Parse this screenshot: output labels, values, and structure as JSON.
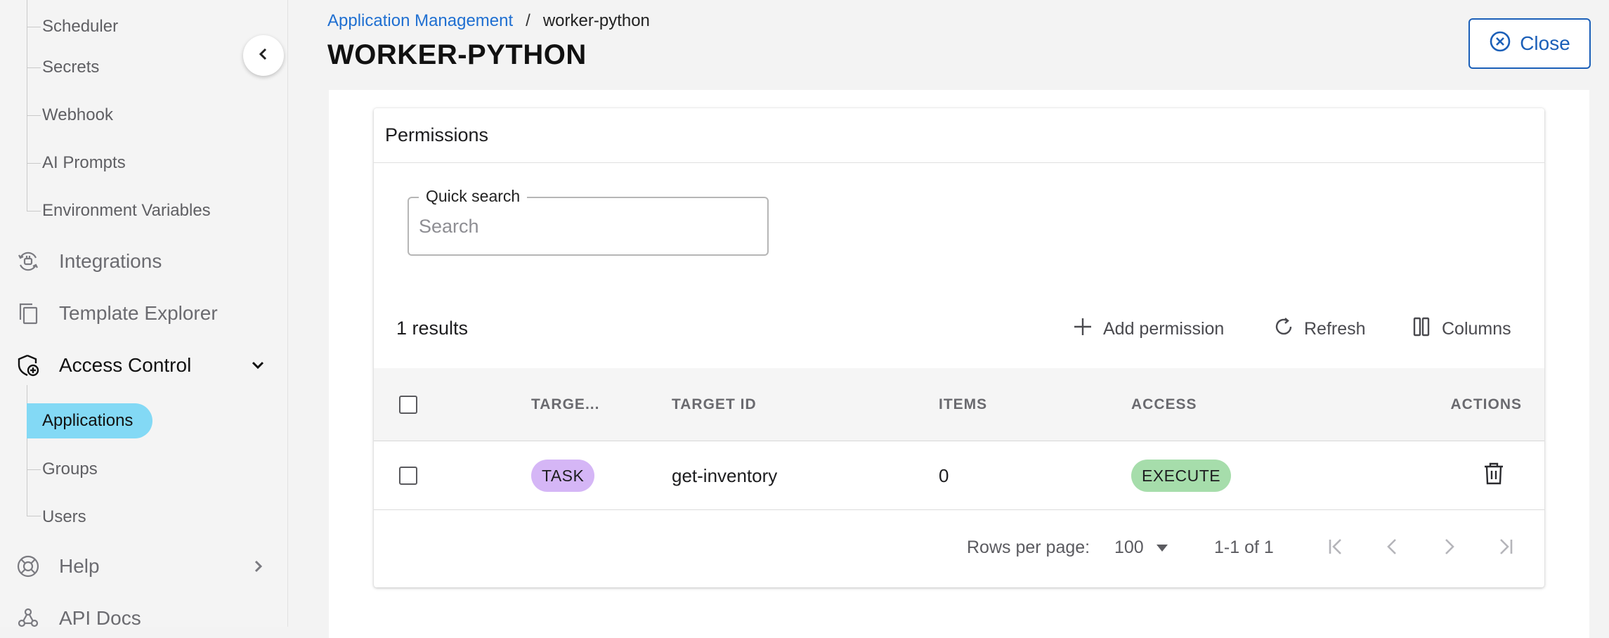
{
  "sidebar": {
    "sub_items_top": [
      {
        "label": "Scheduler"
      },
      {
        "label": "Secrets"
      },
      {
        "label": "Webhook"
      },
      {
        "label": "AI Prompts"
      },
      {
        "label": "Environment Variables"
      }
    ],
    "nav": {
      "integrations": {
        "label": "Integrations",
        "icon": "integrations-icon"
      },
      "template_explorer": {
        "label": "Template Explorer",
        "icon": "copy-icon"
      },
      "access_control": {
        "label": "Access Control",
        "icon": "shield-icon"
      },
      "help": {
        "label": "Help",
        "icon": "lifebuoy-icon"
      },
      "api_docs": {
        "label": "API Docs",
        "icon": "webhook-icon"
      }
    },
    "access_sub": {
      "applications": "Applications",
      "groups": "Groups",
      "users": "Users"
    },
    "active_color": "#83d9f5"
  },
  "breadcrumb": {
    "parent": "Application Management",
    "separator": "/",
    "current": "worker-python"
  },
  "page_title": "WORKER-PYTHON",
  "close_label": "Close",
  "card": {
    "title": "Permissions",
    "search": {
      "legend": "Quick search",
      "placeholder": "Search",
      "value": ""
    },
    "results_text": "1 results",
    "toolbar": {
      "add": "Add permission",
      "refresh": "Refresh",
      "columns": "Columns"
    },
    "columns": [
      "TARGE...",
      "TARGET ID",
      "ITEMS",
      "ACCESS",
      "ACTIONS"
    ],
    "rows": [
      {
        "target_type": "TASK",
        "target_id": "get-inventory",
        "items": "0",
        "access": "EXECUTE"
      }
    ],
    "chip_colors": {
      "task": "#d5b6f6",
      "execute": "#a6ddab"
    },
    "pagination": {
      "rows_per_page_label": "Rows per page:",
      "rows_per_page": "100",
      "range": "1-1 of 1"
    }
  }
}
